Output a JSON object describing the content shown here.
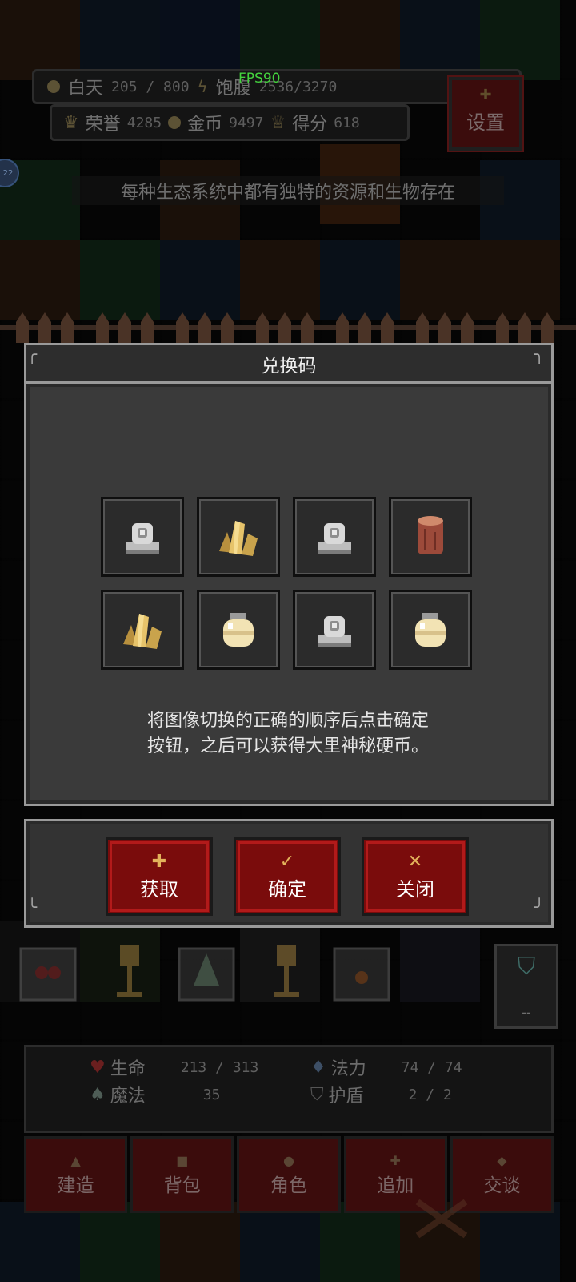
{
  "hud": {
    "day_label": "白天",
    "day_value": "205 / 800",
    "satiety_label": "饱腹",
    "satiety_value": "2536/3270",
    "fps": "FPS90",
    "honor_label": "荣誉",
    "honor_value": "4285",
    "gold_label": "金币",
    "gold_value": "9497",
    "score_label": "得分",
    "score_value": "618",
    "settings_label": "设置",
    "badge": "22"
  },
  "tip": "每种生态系统中都有独特的资源和生物存在",
  "dialog": {
    "title": "兑换码",
    "slots": [
      {
        "icon": "stone-statue-icon"
      },
      {
        "icon": "gold-crystal-icon"
      },
      {
        "icon": "stone-statue-icon"
      },
      {
        "icon": "wood-log-icon"
      },
      {
        "icon": "gold-crystal-icon"
      },
      {
        "icon": "milk-jar-icon"
      },
      {
        "icon": "stone-statue-icon"
      },
      {
        "icon": "milk-jar-icon"
      }
    ],
    "hint_line1": "将图像切换的正确的顺序后点击确定",
    "hint_line2": "按钮，之后可以获得大里神秘硬币。",
    "buttons": {
      "get": "获取",
      "confirm": "确定",
      "close": "关闭"
    }
  },
  "stats": {
    "hp_label": "生命",
    "hp_value": "213 / 313",
    "mana_label": "法力",
    "mana_value": "74 / 74",
    "magic_label": "魔法",
    "magic_value": "35",
    "shield_label": "护盾",
    "shield_value": "2 / 2",
    "side_value": "--"
  },
  "tabs": [
    "建造",
    "背包",
    "角色",
    "追加",
    "交谈"
  ],
  "colors": {
    "accent_red": "#7a0c0c",
    "button_border": "#b21a1a",
    "fps_green": "#44d23e"
  }
}
